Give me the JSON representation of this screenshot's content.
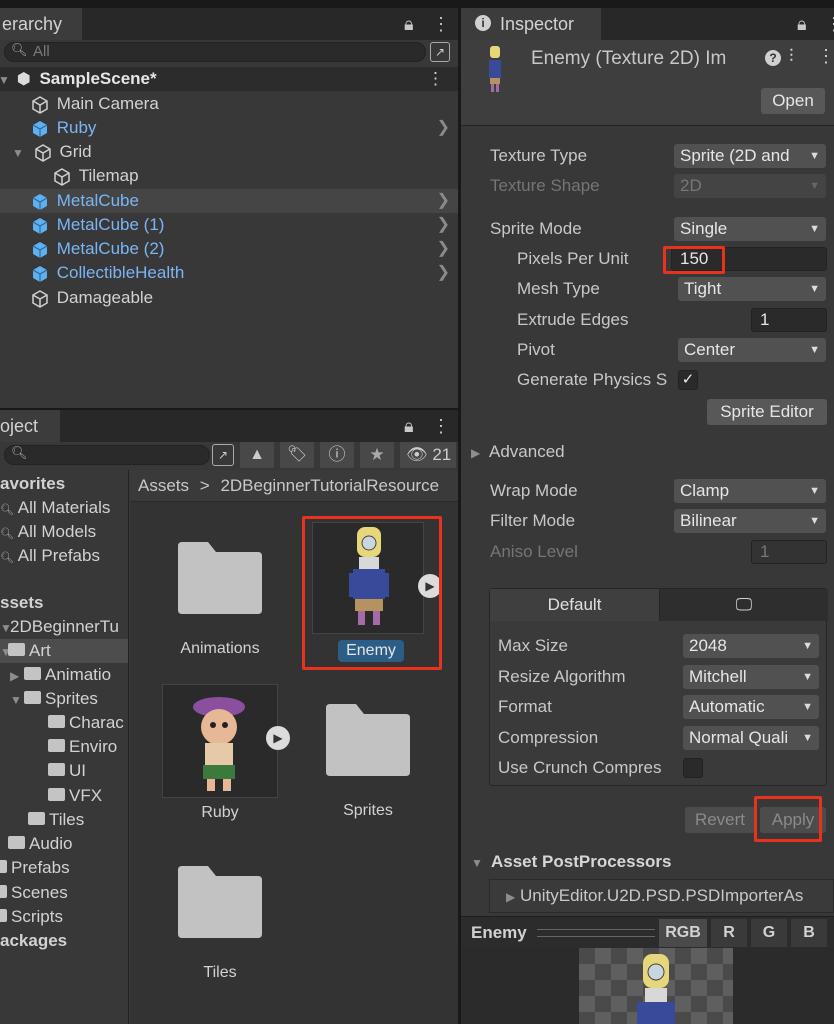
{
  "hierarchy": {
    "tab_label": "erarchy",
    "search_placeholder": "All",
    "scene_name": "SampleScene*",
    "items": [
      {
        "label": "Main Camera"
      },
      {
        "label": "Ruby"
      },
      {
        "label": "Grid"
      },
      {
        "label": "Tilemap"
      },
      {
        "label": "MetalCube"
      },
      {
        "label": "MetalCube (1)"
      },
      {
        "label": "MetalCube (2)"
      },
      {
        "label": "CollectibleHealth"
      },
      {
        "label": "Damageable"
      }
    ]
  },
  "project": {
    "tab_label": "oject",
    "hidden_count": "21",
    "favorites": {
      "label": "avorites",
      "items": [
        "All Materials",
        "All Models",
        "All Prefabs"
      ]
    },
    "assets_label": "ssets",
    "tree": {
      "beginner": "2DBeginnerTu",
      "art": "Art",
      "animations": "Animatio",
      "sprites": "Sprites",
      "characters": "Charac",
      "environment": "Enviro",
      "ui": "UI",
      "vfx": "VFX",
      "tiles": "Tiles",
      "audio": "Audio",
      "prefabs": "Prefabs",
      "scenes": "Scenes",
      "scripts": "Scripts",
      "packages": "ackages"
    },
    "breadcrumb": {
      "root": "Assets",
      "sep": ">",
      "folder": "2DBeginnerTutorialResource"
    },
    "grid": {
      "animations": "Animations",
      "enemy": "Enemy",
      "ruby": "Ruby",
      "sprites": "Sprites",
      "tiles": "Tiles"
    }
  },
  "inspector": {
    "tab_label": "Inspector",
    "title": "Enemy (Texture 2D) Im",
    "open_button": "Open",
    "texture_type": {
      "label": "Texture Type",
      "value": "Sprite (2D and"
    },
    "texture_shape": {
      "label": "Texture Shape",
      "value": "2D"
    },
    "sprite_mode": {
      "label": "Sprite Mode",
      "value": "Single"
    },
    "pixels_per_unit": {
      "label": "Pixels Per Unit",
      "value": "150"
    },
    "mesh_type": {
      "label": "Mesh Type",
      "value": "Tight"
    },
    "extrude_edges": {
      "label": "Extrude Edges",
      "value": "1"
    },
    "pivot": {
      "label": "Pivot",
      "value": "Center"
    },
    "generate_physics": {
      "label": "Generate Physics S",
      "checked": true
    },
    "sprite_editor_button": "Sprite Editor",
    "advanced_label": "Advanced",
    "wrap_mode": {
      "label": "Wrap Mode",
      "value": "Clamp"
    },
    "filter_mode": {
      "label": "Filter Mode",
      "value": "Bilinear"
    },
    "aniso_level": {
      "label": "Aniso Level",
      "value": "1"
    },
    "platform_tab": "Default",
    "max_size": {
      "label": "Max Size",
      "value": "2048"
    },
    "resize_algorithm": {
      "label": "Resize Algorithm",
      "value": "Mitchell"
    },
    "format": {
      "label": "Format",
      "value": "Automatic"
    },
    "compression": {
      "label": "Compression",
      "value": "Normal Quali"
    },
    "use_crunch": {
      "label": "Use Crunch Compres"
    },
    "revert_button": "Revert",
    "apply_button": "Apply",
    "postprocessors_label": "Asset PostProcessors",
    "postprocessor_item": "UnityEditor.U2D.PSD.PSDImporterAs",
    "preview": {
      "title": "Enemy",
      "channels": [
        "RGB",
        "R",
        "G",
        "B"
      ]
    }
  },
  "colors": {
    "accent_blue": "#7bb5f5",
    "highlight_red": "#e8321e",
    "selection": "#2c5d87"
  }
}
